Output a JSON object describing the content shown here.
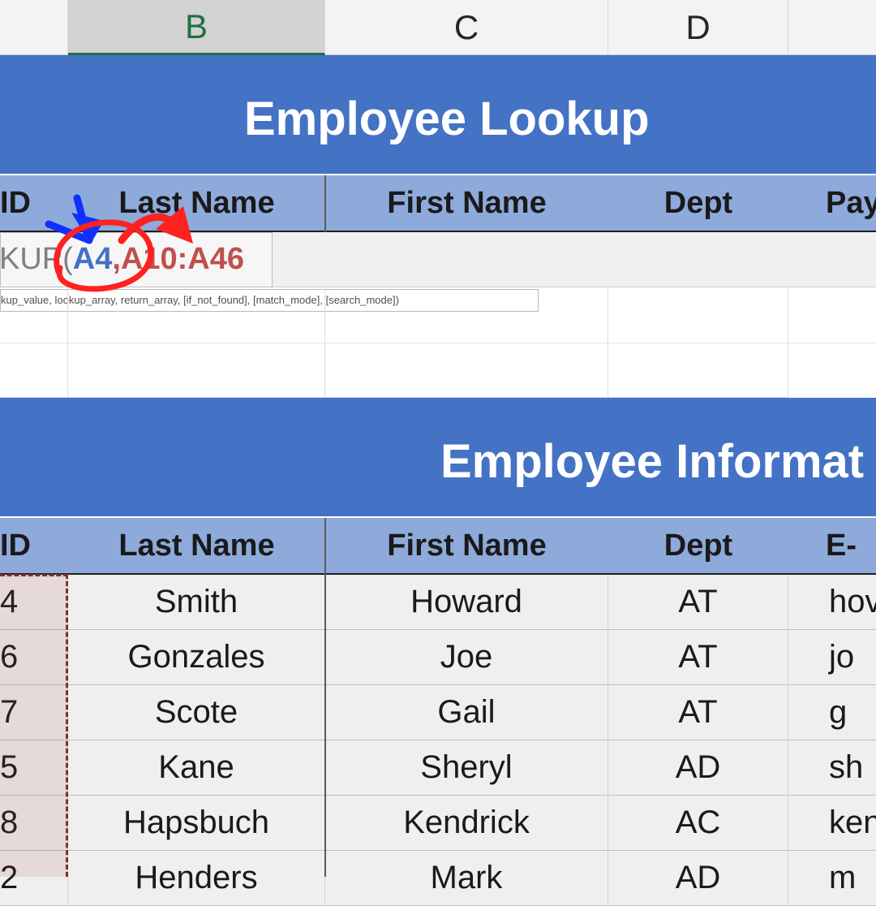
{
  "column_headers": [
    "B",
    "C",
    "D"
  ],
  "lookup": {
    "title": "Employee Lookup",
    "headers": [
      "ID",
      "Last Name",
      "First Name",
      "Dept",
      "Pay"
    ]
  },
  "formula": {
    "prefix": "KUP(",
    "arg1": "A4",
    "sep": ",",
    "arg2": "A10:A46",
    "tooltip": "kup_value, lookup_array, return_array, [if_not_found], [match_mode], [search_mode])"
  },
  "info": {
    "title": "Employee Informat",
    "headers": [
      "ID",
      "Last Name",
      "First Name",
      "Dept",
      "E-"
    ],
    "rows": [
      {
        "id": "4",
        "last": "Smith",
        "first": "Howard",
        "dept": "AT",
        "email": "hov"
      },
      {
        "id": "6",
        "last": "Gonzales",
        "first": "Joe",
        "dept": "AT",
        "email": "jo"
      },
      {
        "id": "7",
        "last": "Scote",
        "first": "Gail",
        "dept": "AT",
        "email": "g"
      },
      {
        "id": "5",
        "last": "Kane",
        "first": "Sheryl",
        "dept": "AD",
        "email": "sh"
      },
      {
        "id": "8",
        "last": "Hapsbuch",
        "first": "Kendrick",
        "dept": "AC",
        "email": "ken"
      },
      {
        "id": "2",
        "last": "Henders",
        "first": "Mark",
        "dept": "AD",
        "email": "m"
      }
    ]
  },
  "colors": {
    "banner": "#4472c4",
    "table_header": "#8eaadb",
    "ref_blue": "#4472c4",
    "ref_red": "#c0504d",
    "annotation_red": "#ff2020",
    "annotation_blue": "#1030ff"
  }
}
